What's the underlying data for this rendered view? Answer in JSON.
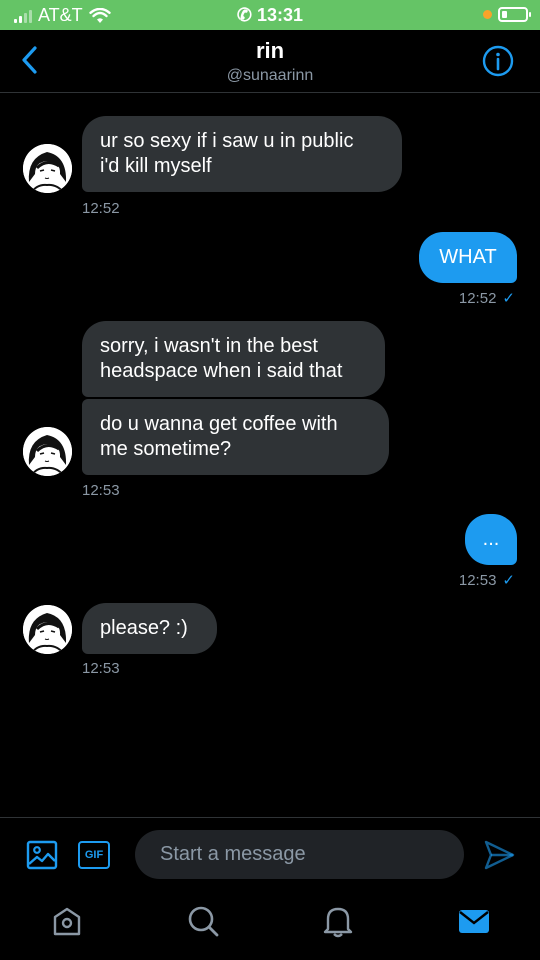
{
  "status_bar": {
    "carrier": "AT&T",
    "time": "13:31",
    "background_color": "#65c466"
  },
  "header": {
    "name": "rin",
    "handle": "@sunaarinn",
    "back_icon": "chevron-left-icon",
    "info_icon": "info-circle-icon"
  },
  "messages": [
    {
      "direction": "received",
      "lines": [
        "ur so sexy if i saw u in public",
        "i'd kill myself"
      ],
      "time": "12:52"
    },
    {
      "direction": "sent",
      "text": "WHAT",
      "time": "12:52",
      "read": "✓"
    },
    {
      "direction": "received",
      "lines": [
        "sorry, i wasn't in the best",
        "headspace when i said that"
      ]
    },
    {
      "direction": "received",
      "lines": [
        "do u wanna get coffee with",
        "me sometime?"
      ],
      "time": "12:53"
    },
    {
      "direction": "sent",
      "text": "...",
      "time": "12:53",
      "read": "✓"
    },
    {
      "direction": "received",
      "lines": [
        "please? :)"
      ],
      "time": "12:53"
    }
  ],
  "composer": {
    "placeholder": "Start a message",
    "image_icon": "image-icon",
    "gif_label": "GIF",
    "send_icon": "send-icon"
  },
  "tabs": [
    {
      "name": "home",
      "icon": "home-icon",
      "active": false
    },
    {
      "name": "search",
      "icon": "search-icon",
      "active": false
    },
    {
      "name": "notifications",
      "icon": "bell-icon",
      "active": false
    },
    {
      "name": "messages",
      "icon": "mail-icon",
      "active": true
    }
  ],
  "colors": {
    "accent": "#1d9bf0",
    "bubble_received": "#2f3336",
    "muted_text": "#8b98a5",
    "background": "#000000"
  }
}
